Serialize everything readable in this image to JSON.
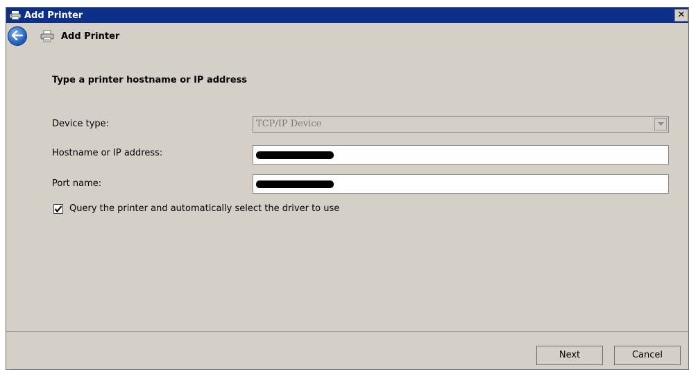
{
  "window": {
    "title": "Add Printer",
    "close_glyph": "✕"
  },
  "nav": {
    "title": "Add Printer"
  },
  "main": {
    "heading": "Type a printer hostname or IP address",
    "device_type_label": "Device type:",
    "device_type_value": "TCP/IP Device",
    "hostname_label": "Hostname or IP address:",
    "port_label": "Port name:",
    "query_checkbox_label": "Query the printer and automatically select the driver to use",
    "query_checkbox_checked": true
  },
  "footer": {
    "next_label": "Next",
    "cancel_label": "Cancel"
  },
  "icons": {
    "title": "printer-icon",
    "back": "back-arrow-icon",
    "nav": "printer-icon",
    "dropdown": "chevron-down-icon",
    "check": "checkmark-icon"
  },
  "colors": {
    "titlebar": "#0c2f8a",
    "dialog_bg": "#d4d0c8",
    "back_button": "#1a57b8"
  }
}
